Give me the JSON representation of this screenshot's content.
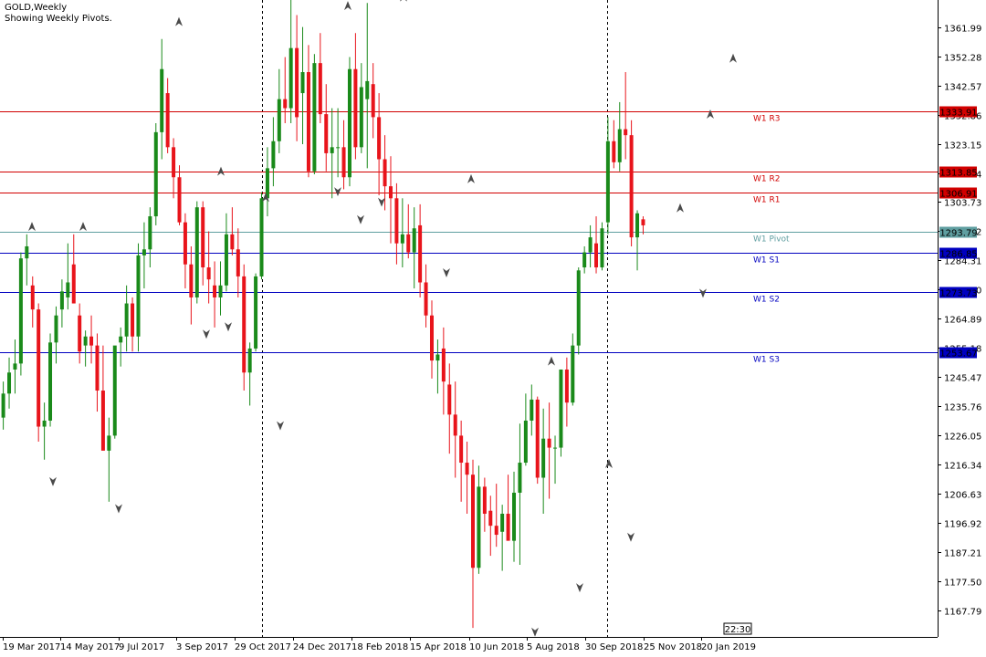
{
  "header": {
    "symbol_line": "GOLD,Weekly",
    "status_line": "Showing Weekly Pivots."
  },
  "time_badge": "22:30",
  "chart_data": {
    "type": "candlestick",
    "symbol": "GOLD",
    "timeframe": "Weekly",
    "ylim": [
      1159,
      1371
    ],
    "y_ticks": [
      "1361.99",
      "1352.28",
      "1342.57",
      "1332.86",
      "1323.15",
      "1313.44",
      "1303.73",
      "1294.02",
      "1284.31",
      "1274.60",
      "1264.89",
      "1255.18",
      "1245.47",
      "1235.76",
      "1226.05",
      "1216.34",
      "1206.63",
      "1196.92",
      "1187.21",
      "1177.50",
      "1167.79"
    ],
    "x_labels": [
      "19 Mar 2017",
      "14 May 2017",
      "9 Jul 2017",
      "3 Sep 2017",
      "29 Oct 2017",
      "24 Dec 2017",
      "18 Feb 2018",
      "15 Apr 2018",
      "10 Jun 2018",
      "5 Aug 2018",
      "30 Sep 2018",
      "25 Nov 2018",
      "20 Jan 2019"
    ],
    "colors": {
      "bull": "#1a8a1a",
      "bear": "#e8141b",
      "resistance": "#d10000",
      "support": "#0000c0",
      "pivot": "#5f9ea0"
    },
    "pivot_levels": [
      {
        "name": "W1 R3",
        "value": 1333.91,
        "label": "1333.91",
        "kind": "resistance"
      },
      {
        "name": "W1 R2",
        "value": 1313.85,
        "label": "1313.85",
        "kind": "resistance"
      },
      {
        "name": "W1 R1",
        "value": 1306.91,
        "label": "1306.91",
        "kind": "resistance"
      },
      {
        "name": "W1 Pivot",
        "value": 1293.79,
        "label": "1293.79",
        "kind": "pivot"
      },
      {
        "name": "W1 S1",
        "value": 1286.85,
        "label": "1286.85",
        "kind": "support"
      },
      {
        "name": "W1 S2",
        "value": 1273.73,
        "label": "1273.73",
        "kind": "support"
      },
      {
        "name": "W1 S3",
        "value": 1253.67,
        "label": "1253.67",
        "kind": "support"
      }
    ],
    "period_separators": [
      "24 Dec 2017",
      "20 Jan 2019"
    ],
    "fractal_high_values": [
      1293.8,
      1293.8,
      1362.0,
      1312.2,
      1303.5,
      1371.4,
      1367.3,
      1370.2,
      1309.7,
      1249.0,
      1214.9,
      1300.0,
      1331.2,
      1349.8,
      1294.5
    ],
    "fractal_low_values": [
      1212.5,
      1203.5,
      1261.6,
      1264.0,
      1231.1,
      1309.0,
      1299.7,
      1305.5,
      1282.0,
      1162.4,
      1177.2,
      1194.0,
      1275.2
    ],
    "ohlc": [
      [
        1232.0,
        1244.0,
        1228.0,
        1240.0
      ],
      [
        1240.0,
        1252.0,
        1235.0,
        1247.0
      ],
      [
        1248.0,
        1258.0,
        1240.0,
        1250.0
      ],
      [
        1250.0,
        1287.0,
        1246.0,
        1285.0
      ],
      [
        1285.0,
        1293.0,
        1276.0,
        1289.0
      ],
      [
        1276.0,
        1279.0,
        1262.0,
        1268.0
      ],
      [
        1268.0,
        1270.0,
        1224.0,
        1229.0
      ],
      [
        1229.0,
        1237.0,
        1218.0,
        1231.0
      ],
      [
        1231.0,
        1260.0,
        1229.0,
        1257.0
      ],
      [
        1257.0,
        1269.0,
        1250.0,
        1266.0
      ],
      [
        1268.0,
        1278.0,
        1262.0,
        1274.0
      ],
      [
        1272.0,
        1290.0,
        1268.0,
        1277.0
      ],
      [
        1283.0,
        1293.0,
        1270.0,
        1270.0
      ],
      [
        1266.0,
        1270.0,
        1250.0,
        1254.0
      ],
      [
        1256.0,
        1261.0,
        1249.0,
        1259.0
      ],
      [
        1259.0,
        1266.0,
        1250.0,
        1256.0
      ],
      [
        1256.0,
        1260.0,
        1234.0,
        1241.0
      ],
      [
        1241.0,
        1256.0,
        1222.0,
        1221.0
      ],
      [
        1221.0,
        1232.0,
        1204.0,
        1226.0
      ],
      [
        1226.0,
        1252.0,
        1225.0,
        1256.0
      ],
      [
        1257.0,
        1262.0,
        1249.0,
        1259.0
      ],
      [
        1259.0,
        1276.0,
        1254.0,
        1270.0
      ],
      [
        1270.0,
        1272.0,
        1254.0,
        1259.0
      ],
      [
        1259.0,
        1290.0,
        1254.0,
        1286.0
      ],
      [
        1286.0,
        1297.0,
        1275.0,
        1288.0
      ],
      [
        1288.0,
        1302.0,
        1282.0,
        1299.0
      ],
      [
        1299.0,
        1330.0,
        1296.0,
        1327.0
      ],
      [
        1327.0,
        1358.0,
        1318.0,
        1348.0
      ],
      [
        1340.0,
        1345.0,
        1320.0,
        1322.0
      ],
      [
        1322.0,
        1325.0,
        1305.0,
        1312.0
      ],
      [
        1312.0,
        1316.0,
        1296.0,
        1297.0
      ],
      [
        1297.0,
        1300.0,
        1275.0,
        1283.0
      ],
      [
        1283.0,
        1289.0,
        1263.0,
        1272.0
      ],
      [
        1272.0,
        1304.0,
        1270.0,
        1302.0
      ],
      [
        1302.0,
        1304.0,
        1276.0,
        1282.0
      ],
      [
        1282.0,
        1294.0,
        1270.0,
        1278.0
      ],
      [
        1276.0,
        1284.0,
        1262.0,
        1272.0
      ],
      [
        1272.0,
        1284.0,
        1266.0,
        1276.0
      ],
      [
        1276.0,
        1300.0,
        1274.0,
        1293.0
      ],
      [
        1293.0,
        1302.0,
        1286.0,
        1288.0
      ],
      [
        1288.0,
        1295.0,
        1272.0,
        1279.0
      ],
      [
        1279.0,
        1283.0,
        1241.0,
        1247.0
      ],
      [
        1247.0,
        1257.0,
        1236.0,
        1255.0
      ],
      [
        1255.0,
        1280.0,
        1254.0,
        1279.0
      ],
      [
        1279.0,
        1307.0,
        1278.0,
        1305.0
      ],
      [
        1305.0,
        1322.0,
        1299.0,
        1315.0
      ],
      [
        1315.0,
        1332.0,
        1309.0,
        1324.0
      ],
      [
        1324.0,
        1348.0,
        1320.0,
        1338.0
      ],
      [
        1338.0,
        1352.0,
        1330.0,
        1335.0
      ],
      [
        1335.0,
        1371.0,
        1330.0,
        1355.0
      ],
      [
        1355.0,
        1366.0,
        1324.0,
        1332.0
      ],
      [
        1340.0,
        1362.0,
        1323.0,
        1347.0
      ],
      [
        1347.0,
        1356.0,
        1312.0,
        1314.0
      ],
      [
        1314.0,
        1353.0,
        1313.0,
        1350.0
      ],
      [
        1350.0,
        1360.0,
        1330.0,
        1333.0
      ],
      [
        1333.0,
        1343.0,
        1314.0,
        1320.0
      ],
      [
        1320.0,
        1335.0,
        1305.0,
        1322.0
      ],
      [
        1322.0,
        1335.0,
        1312.0,
        1322.0
      ],
      [
        1322.0,
        1331.0,
        1308.0,
        1312.0
      ],
      [
        1312.0,
        1352.0,
        1309.0,
        1348.0
      ],
      [
        1348.0,
        1360.0,
        1318.0,
        1322.0
      ],
      [
        1322.0,
        1350.0,
        1320.0,
        1342.0
      ],
      [
        1338.0,
        1370.0,
        1315.0,
        1344.0
      ],
      [
        1343.0,
        1350.0,
        1325.0,
        1332.0
      ],
      [
        1332.0,
        1340.0,
        1306.0,
        1318.0
      ],
      [
        1318.0,
        1326.0,
        1301.0,
        1309.0
      ],
      [
        1309.0,
        1319.0,
        1290.0,
        1305.0
      ],
      [
        1305.0,
        1310.0,
        1283.0,
        1290.0
      ],
      [
        1290.0,
        1305.0,
        1282.0,
        1293.0
      ],
      [
        1293.0,
        1303.0,
        1285.0,
        1287.0
      ],
      [
        1287.0,
        1302.0,
        1275.0,
        1295.0
      ],
      [
        1296.0,
        1303.0,
        1272.0,
        1277.0
      ],
      [
        1277.0,
        1283.0,
        1262.0,
        1266.0
      ],
      [
        1266.0,
        1271.0,
        1245.0,
        1251.0
      ],
      [
        1251.0,
        1258.0,
        1240.0,
        1253.0
      ],
      [
        1255.0,
        1262.0,
        1233.0,
        1244.0
      ],
      [
        1243.0,
        1250.0,
        1220.0,
        1233.0
      ],
      [
        1233.0,
        1244.0,
        1212.0,
        1226.0
      ],
      [
        1226.0,
        1231.0,
        1204.0,
        1217.0
      ],
      [
        1217.0,
        1224.0,
        1200.0,
        1213.0
      ],
      [
        1213.0,
        1218.0,
        1162.0,
        1182.0
      ],
      [
        1182.0,
        1216.0,
        1180.0,
        1209.0
      ],
      [
        1209.0,
        1212.0,
        1194.0,
        1200.0
      ],
      [
        1201.0,
        1206.0,
        1186.0,
        1196.0
      ],
      [
        1196.0,
        1210.0,
        1189.0,
        1193.0
      ],
      [
        1194.0,
        1203.0,
        1181.0,
        1200.0
      ],
      [
        1200.0,
        1213.0,
        1196.0,
        1191.0
      ],
      [
        1191.0,
        1214.0,
        1184.0,
        1207.0
      ],
      [
        1207.0,
        1230.0,
        1183.0,
        1217.0
      ],
      [
        1217.0,
        1240.0,
        1216.0,
        1231.0
      ],
      [
        1231.0,
        1243.0,
        1226.0,
        1238.0
      ],
      [
        1238.0,
        1239.0,
        1210.0,
        1212.0
      ],
      [
        1212.0,
        1235.0,
        1200.0,
        1225.0
      ],
      [
        1225.0,
        1237.0,
        1205.0,
        1222.0
      ],
      [
        1222.0,
        1226.0,
        1210.0,
        1222.0
      ],
      [
        1222.0,
        1248.0,
        1219.0,
        1248.0
      ],
      [
        1248.0,
        1252.0,
        1229.0,
        1237.0
      ],
      [
        1237.0,
        1260.0,
        1236.0,
        1256.0
      ],
      [
        1256.0,
        1282.0,
        1253.0,
        1281.0
      ],
      [
        1282.0,
        1289.0,
        1280.0,
        1287.0
      ],
      [
        1287.0,
        1296.0,
        1282.0,
        1292.0
      ],
      [
        1290.0,
        1299.0,
        1280.0,
        1282.0
      ],
      [
        1282.0,
        1297.0,
        1281.0,
        1295.0
      ],
      [
        1297.0,
        1332.0,
        1293.0,
        1324.0
      ],
      [
        1324.0,
        1331.0,
        1315.0,
        1317.0
      ],
      [
        1317.0,
        1337.0,
        1314.0,
        1328.0
      ],
      [
        1328.0,
        1347.0,
        1318.0,
        1326.0
      ],
      [
        1326.0,
        1331.0,
        1289.0,
        1292.0
      ],
      [
        1292.0,
        1301.0,
        1281.0,
        1300.0
      ],
      [
        1298.0,
        1299.0,
        1293.0,
        1296.0
      ]
    ]
  }
}
